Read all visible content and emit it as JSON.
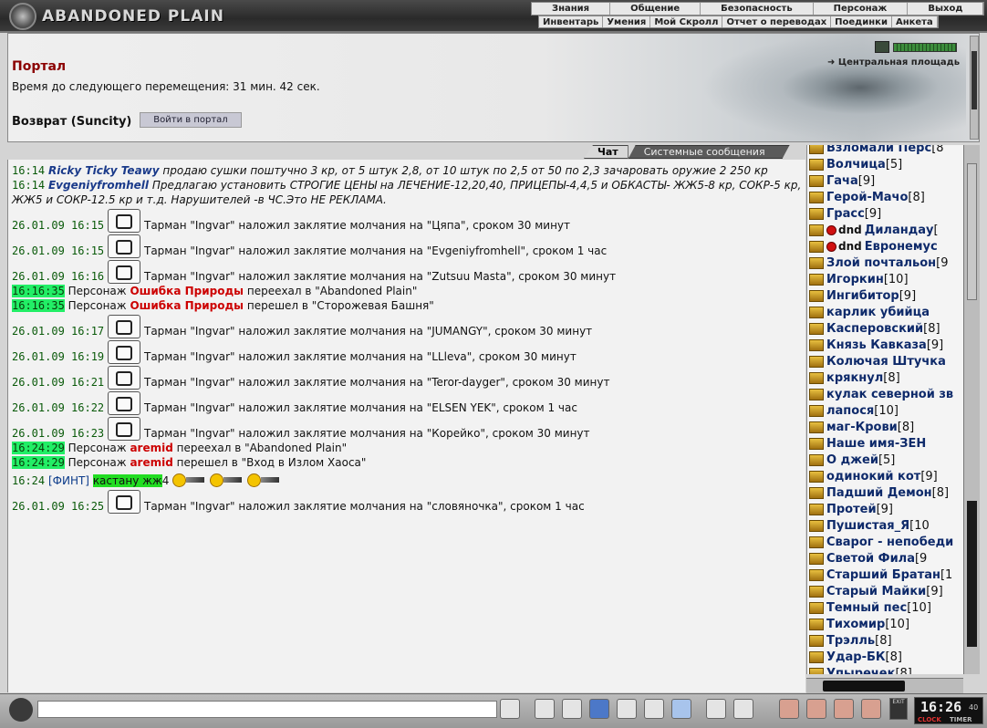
{
  "header": {
    "logo_text": "ABANDONED PLAIN",
    "menu_main": [
      "Знания",
      "Общение",
      "Безопасность",
      "Персонаж",
      "Выход"
    ],
    "menu_sub": [
      "Инвентарь",
      "Умения",
      "Мой Скролл",
      "Отчет о переводах",
      "Поединки",
      "Анкета"
    ]
  },
  "portal": {
    "title": "Портал",
    "time_text": "Время до следующего перемещения: 31 мин. 42 сек.",
    "return_label": "Возврат (Suncity)",
    "enter_button": "Войти в портал",
    "location": "Центральная площадь"
  },
  "chat": {
    "tabs": [
      "Чат",
      "Системные сообщения"
    ],
    "active_tab": "Чат",
    "messages": [
      {
        "time": "16:14",
        "nick": "Ricky Ticky Teawy",
        "text": "продаю сушки поштучно 3 кр, от 5 штук 2,8, от 10 штук по 2,5 от 50 по 2,3 зачаровать оружие 2 250 кр"
      },
      {
        "time": "16:14",
        "nick": "Evgeniyfromhell",
        "text": "Предлагаю установить СТРОГИЕ ЦЕНЫ на ЛЕЧЕНИЕ-12,20,40, ПРИЦЕПЫ-4,4,5 и ОБКАСТЫ- ЖЖ5-8 кр, СОКР-5 кр, ЖЖ5 и СОКР-12.5 кр и т.д. Нарушителей -в ЧС.Это НЕ РЕКЛАМА."
      },
      {
        "time": "26.01.09 16:15",
        "text": "Тарман \"Ingvar\" наложил заклятие молчания на \"Цяпа\", сроком 30 минут"
      },
      {
        "time": "26.01.09 16:15",
        "text": "Тарман \"Ingvar\" наложил заклятие молчания на \"Evgeniyfromhell\", сроком 1 час"
      },
      {
        "time": "26.01.09 16:16",
        "text": "Тарман \"Ingvar\" наложил заклятие молчания на \"Zutsuu Masta\", сроком 30 минут"
      },
      {
        "time": "16:16:35",
        "pre": "Персонаж",
        "name": "Ошибка Природы",
        "text": "переехал в \"Abandoned Plain\""
      },
      {
        "time": "16:16:35",
        "pre": "Персонаж",
        "name": "Ошибка Природы",
        "text": "перешел в \"Сторожевая Башня\""
      },
      {
        "time": "26.01.09 16:17",
        "text": "Тарман \"Ingvar\" наложил заклятие молчания на \"JUMANGY\", сроком 30 минут"
      },
      {
        "time": "26.01.09 16:19",
        "text": "Тарман \"Ingvar\" наложил заклятие молчания на \"LLleva\", сроком 30 минут"
      },
      {
        "time": "26.01.09 16:21",
        "text": "Тарман \"Ingvar\" наложил заклятие молчания на \"Teror-dayger\", сроком 30 минут"
      },
      {
        "time": "26.01.09 16:22",
        "text": "Тарман \"Ingvar\" наложил заклятие молчания на \"ELSEN YEK\", сроком 1 час"
      },
      {
        "time": "26.01.09 16:23",
        "text": "Тарман \"Ingvar\" наложил заклятие молчания на \"Корейко\", сроком 30 минут"
      },
      {
        "time": "16:24:29",
        "pre": "Персонаж",
        "name": "aremid",
        "text": "переехал в \"Abandoned Plain\""
      },
      {
        "time": "16:24:29",
        "pre": "Персонаж",
        "name": "aremid",
        "text": "перешел в \"Вход в Излом Хаоса\""
      },
      {
        "time": "16:24",
        "tag": "[ФИНТ]",
        "highlight": "кастану жж",
        "suffix": "4"
      },
      {
        "time": "26.01.09 16:25",
        "text": "Тарман \"Ingvar\" наложил заклятие молчания на \"словяночка\", сроком 1 час"
      }
    ]
  },
  "users": [
    {
      "name": "Взломали Перс",
      "level": "[8"
    },
    {
      "name": "Волчица",
      "level": "[5]"
    },
    {
      "name": "Гача",
      "level": "[9]"
    },
    {
      "name": "Герой-Мачо",
      "level": "[8]"
    },
    {
      "name": "Грасс",
      "level": "[9]"
    },
    {
      "name": "Диландау",
      "level": "[",
      "prefix": "dnd"
    },
    {
      "name": "Евронемус",
      "level": "",
      "prefix": "dnd"
    },
    {
      "name": "Злой почтальон",
      "level": "[9"
    },
    {
      "name": "Игоркин",
      "level": "[10]"
    },
    {
      "name": "Ингибитор",
      "level": "[9]"
    },
    {
      "name": "карлик убийца",
      "level": ""
    },
    {
      "name": "Касперовский",
      "level": "[8]"
    },
    {
      "name": "Князь Кавказа",
      "level": "[9]"
    },
    {
      "name": "Колючая Штучка",
      "level": ""
    },
    {
      "name": "крякнул",
      "level": "[8]"
    },
    {
      "name": "кулак северной зв",
      "level": ""
    },
    {
      "name": "лапося",
      "level": "[10]"
    },
    {
      "name": "маг-Крови",
      "level": "[8]"
    },
    {
      "name": "Наше имя-ЗЕН",
      "level": ""
    },
    {
      "name": "О джей",
      "level": "[5]"
    },
    {
      "name": "одинокий кот",
      "level": "[9]"
    },
    {
      "name": "Падший Демон",
      "level": "[8]"
    },
    {
      "name": "Протей",
      "level": "[9]"
    },
    {
      "name": "Пушистая_Я",
      "level": "[10"
    },
    {
      "name": "Сварог - непобеди",
      "level": ""
    },
    {
      "name": "Светой Фила",
      "level": "[9"
    },
    {
      "name": "Старший Братан",
      "level": "[1"
    },
    {
      "name": "Старый Майки",
      "level": "[9]"
    },
    {
      "name": "Темный пес",
      "level": "[10]"
    },
    {
      "name": "Тихомир",
      "level": "[10]"
    },
    {
      "name": "Трэлль",
      "level": "[8]"
    },
    {
      "name": "Удар-БК",
      "level": "[8]"
    },
    {
      "name": "Упыречек",
      "level": "[8]"
    }
  ],
  "clock": {
    "time": "16:26",
    "sec": "40",
    "label_left": "CLOCK",
    "label_right": "TIMER"
  },
  "exit_label": "EXIT",
  "colors": {
    "accent_red": "#8b0000",
    "timestamp_green": "#22ee66",
    "nick_blue": "#1a3a8a"
  }
}
